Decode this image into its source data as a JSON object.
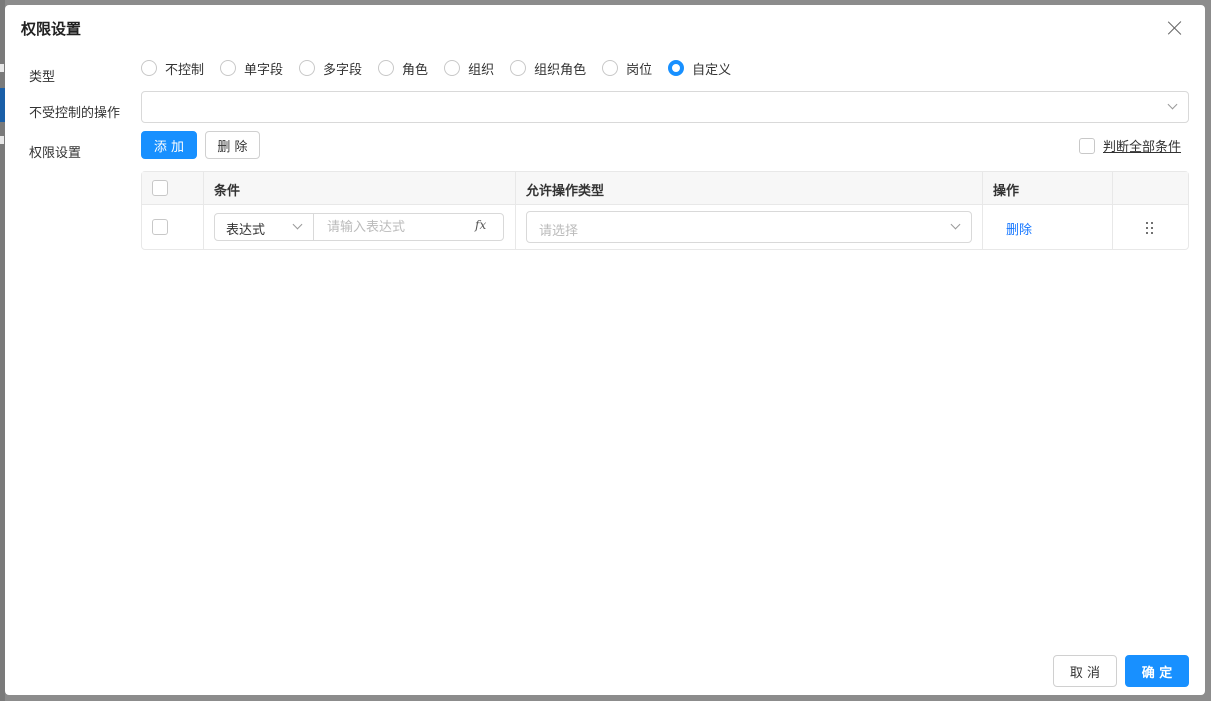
{
  "dialog": {
    "title": "权限设置"
  },
  "form": {
    "type_label": "类型",
    "type_options": [
      "不控制",
      "单字段",
      "多字段",
      "角色",
      "组织",
      "组织角色",
      "岗位",
      "自定义"
    ],
    "type_selected": "自定义",
    "uncontrolled_label": "不受控制的操作",
    "uncontrolled_value": "",
    "permission_label": "权限设置"
  },
  "toolbar": {
    "add_label": "添 加",
    "delete_label": "删 除",
    "check_all_label": "判断全部条件"
  },
  "table": {
    "headers": [
      "条件",
      "允许操作类型",
      "操作"
    ],
    "rows": [
      {
        "condition_type": "表达式",
        "expression_placeholder": "请输入表达式",
        "fx_label": "fx",
        "operation_placeholder": "请选择",
        "action_label": "删除"
      }
    ]
  },
  "footer": {
    "cancel_label": "取 消",
    "ok_label": "确 定"
  },
  "colors": {
    "primary": "#1890ff",
    "link": "#1677ff"
  }
}
